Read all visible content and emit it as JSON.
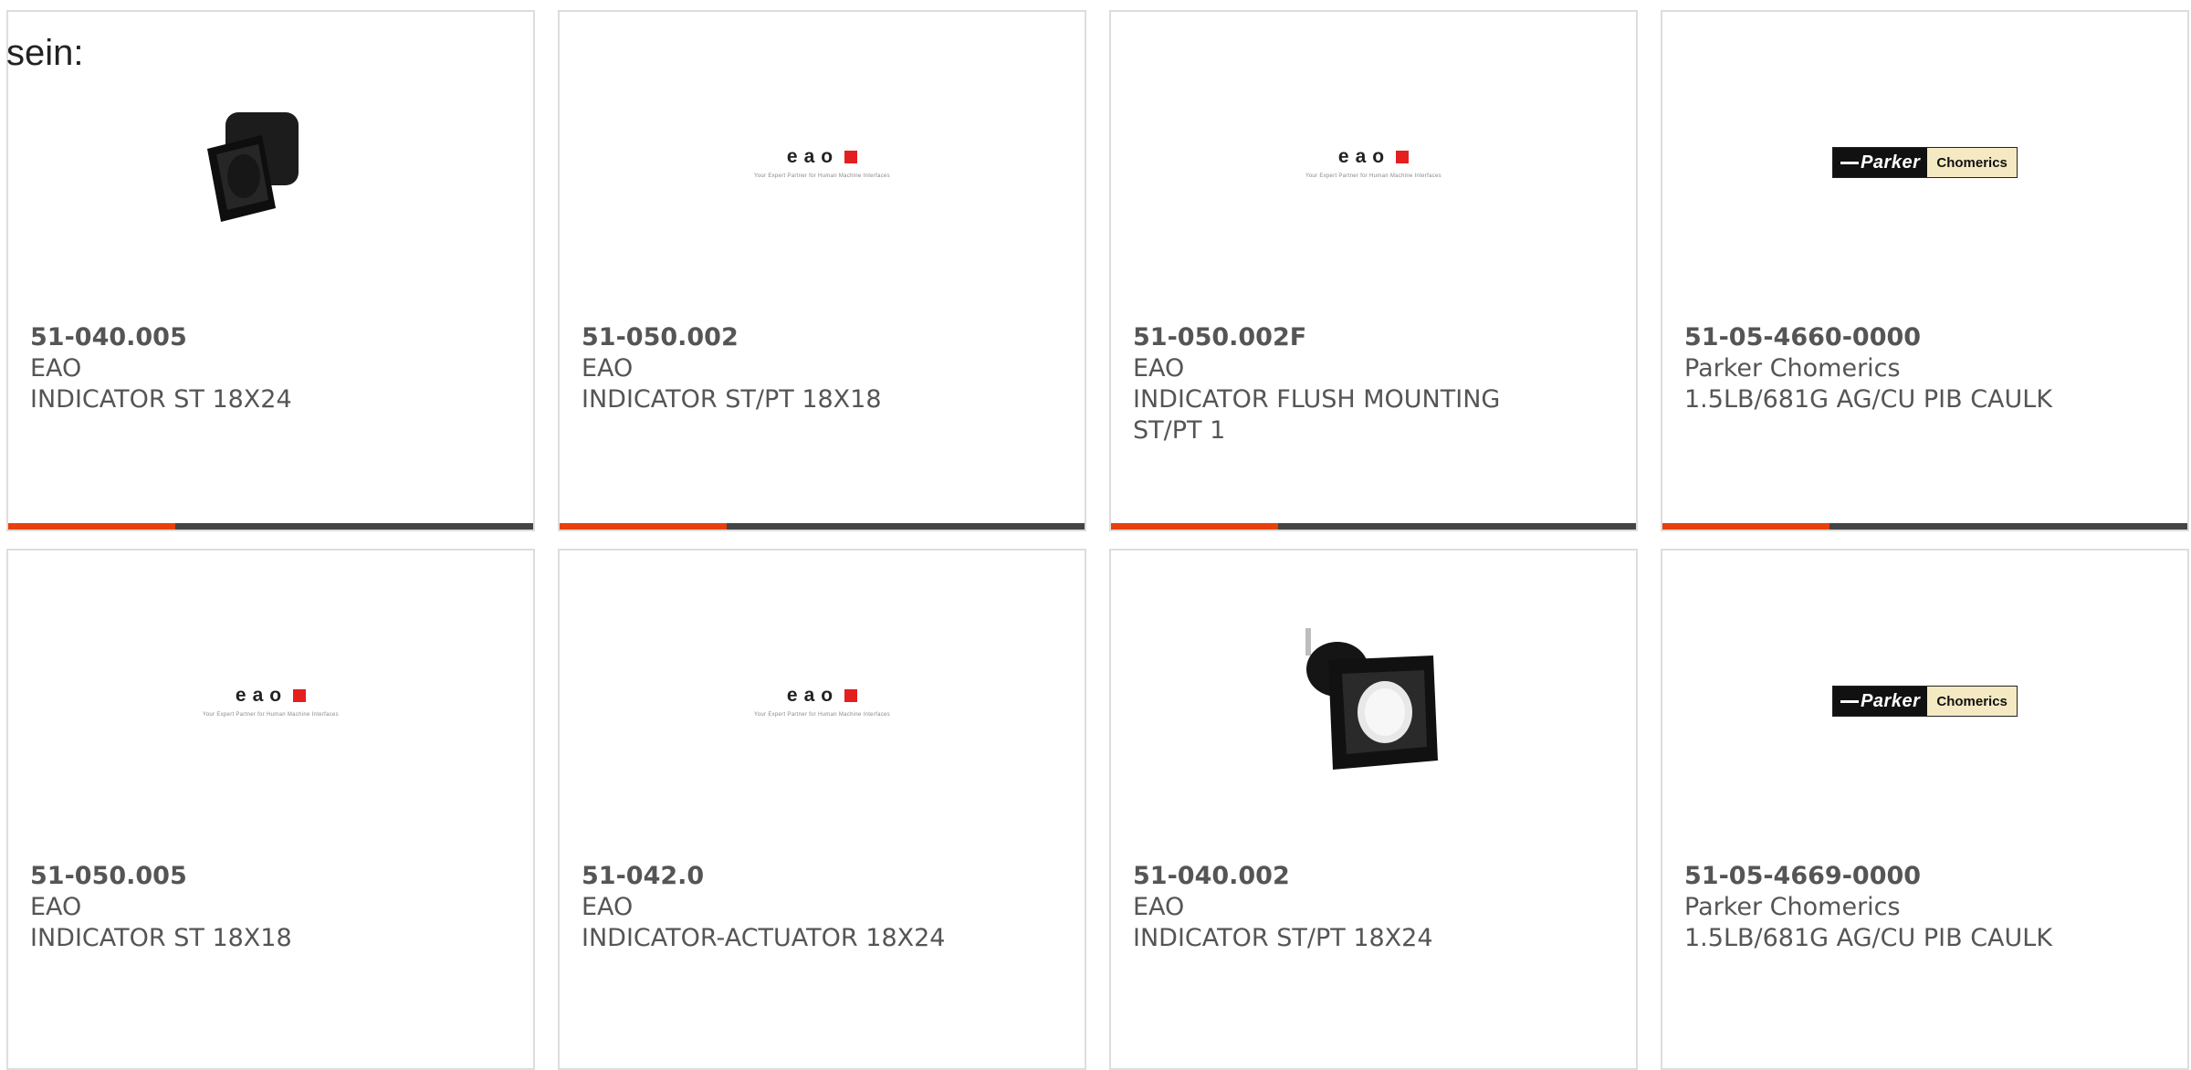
{
  "intro_text": "sein:",
  "colors": {
    "accent_red": "#e8400c",
    "accent_dark": "#444444",
    "border": "#dddddd"
  },
  "products": [
    {
      "part": "51-040.005",
      "brand": "EAO",
      "desc": "INDICATOR ST 18X24",
      "image": "indicator-photo-front"
    },
    {
      "part": "51-050.002",
      "brand": "EAO",
      "desc": "INDICATOR ST/PT 18X18",
      "image": "eao-logo"
    },
    {
      "part": "51-050.002F",
      "brand": "EAO",
      "desc": "INDICATOR FLUSH MOUNTING ST/PT 1",
      "image": "eao-logo"
    },
    {
      "part": "51-05-4660-0000",
      "brand": "Parker Chomerics",
      "desc": "1.5LB/681G AG/CU PIB CAULK",
      "image": "parker-chomerics-logo"
    },
    {
      "part": "51-050.005",
      "brand": "EAO",
      "desc": "INDICATOR ST 18X18",
      "image": "eao-logo"
    },
    {
      "part": "51-042.0",
      "brand": "EAO",
      "desc": "INDICATOR-ACTUATOR 18X24",
      "image": "eao-logo"
    },
    {
      "part": "51-040.002",
      "brand": "EAO",
      "desc": "INDICATOR ST/PT 18X24",
      "image": "indicator-photo-angled"
    },
    {
      "part": "51-05-4669-0000",
      "brand": "Parker Chomerics",
      "desc": "1.5LB/681G AG/CU PIB CAULK",
      "image": "parker-chomerics-logo"
    }
  ],
  "logos": {
    "eao_letters": "eao",
    "eao_tagline": "Your Expert Partner for Human Machine Interfaces",
    "parker_name": "Parker",
    "parker_division": "Chomerics"
  }
}
